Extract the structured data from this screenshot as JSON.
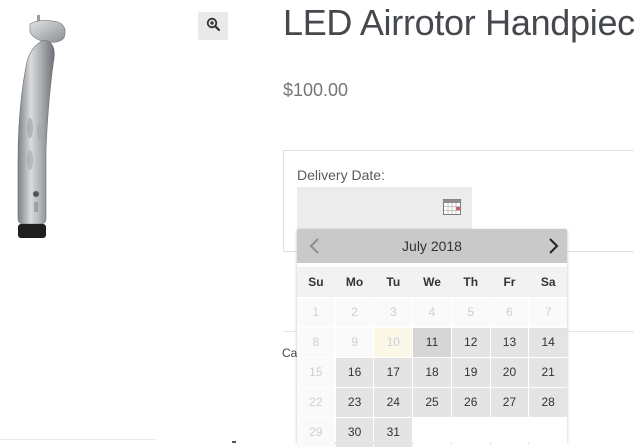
{
  "product": {
    "title": "LED Airrotor Handpiece",
    "price": "$100.00"
  },
  "delivery": {
    "label": "Delivery Date:",
    "input_value": ""
  },
  "category_partial": "Ca",
  "calendar": {
    "month": "July 2018",
    "weekdays": [
      "Su",
      "Mo",
      "Tu",
      "We",
      "Th",
      "Fr",
      "Sa"
    ],
    "weeks": [
      [
        {
          "d": "1",
          "s": "disabled"
        },
        {
          "d": "2",
          "s": "disabled"
        },
        {
          "d": "3",
          "s": "disabled"
        },
        {
          "d": "4",
          "s": "disabled"
        },
        {
          "d": "5",
          "s": "disabled"
        },
        {
          "d": "6",
          "s": "disabled"
        },
        {
          "d": "7",
          "s": "disabled"
        }
      ],
      [
        {
          "d": "8",
          "s": "disabled"
        },
        {
          "d": "9",
          "s": "disabled"
        },
        {
          "d": "10",
          "s": "today"
        },
        {
          "d": "11",
          "s": "avail sel"
        },
        {
          "d": "12",
          "s": "avail"
        },
        {
          "d": "13",
          "s": "avail"
        },
        {
          "d": "14",
          "s": "avail"
        }
      ],
      [
        {
          "d": "15",
          "s": "disabled"
        },
        {
          "d": "16",
          "s": "avail"
        },
        {
          "d": "17",
          "s": "avail"
        },
        {
          "d": "18",
          "s": "avail"
        },
        {
          "d": "19",
          "s": "avail"
        },
        {
          "d": "20",
          "s": "avail"
        },
        {
          "d": "21",
          "s": "avail"
        }
      ],
      [
        {
          "d": "22",
          "s": "disabled"
        },
        {
          "d": "23",
          "s": "avail"
        },
        {
          "d": "24",
          "s": "avail"
        },
        {
          "d": "25",
          "s": "avail"
        },
        {
          "d": "26",
          "s": "avail"
        },
        {
          "d": "27",
          "s": "avail"
        },
        {
          "d": "28",
          "s": "avail"
        }
      ],
      [
        {
          "d": "29",
          "s": "disabled"
        },
        {
          "d": "30",
          "s": "avail"
        },
        {
          "d": "31",
          "s": "avail"
        },
        {
          "d": "",
          "s": "empty"
        },
        {
          "d": "",
          "s": "empty"
        },
        {
          "d": "",
          "s": "empty"
        },
        {
          "d": "",
          "s": "empty"
        }
      ]
    ]
  },
  "icons": {
    "zoom": "zoom-in-icon",
    "calendar": "calendar-icon",
    "prev": "chevron-left-icon",
    "next": "chevron-right-icon"
  },
  "colors": {
    "title": "#45484c",
    "price": "#767676",
    "calendar_header": "#c9c9c9",
    "available_day": "#e4e4e4",
    "today_highlight": "#fbf8e8"
  }
}
